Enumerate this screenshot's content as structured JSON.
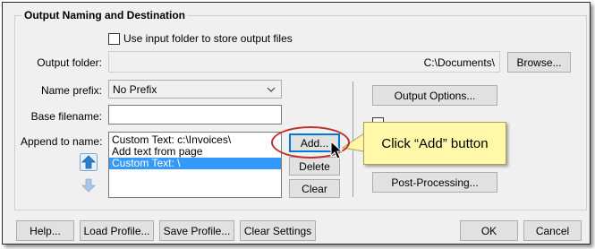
{
  "group": {
    "title": "Output Naming and Destination"
  },
  "checkbox_input_folder": {
    "label": "Use input folder to store output files",
    "checked": false
  },
  "output_folder": {
    "label": "Output folder:",
    "value": "C:\\Documents\\",
    "browse_label": "Browse..."
  },
  "name_prefix": {
    "label": "Name prefix:",
    "value": "No Prefix"
  },
  "base_filename": {
    "label": "Base filename:",
    "value": ""
  },
  "append_to_name": {
    "label": "Append to name:",
    "items": [
      "Custom Text: c:\\Invoices\\",
      "Add text from page",
      "Custom Text: \\"
    ],
    "selected_index": 2,
    "add_label": "Add...",
    "delete_label": "Delete",
    "clear_label": "Clear"
  },
  "right_panel": {
    "output_options_label": "Output Options...",
    "post_processing_label": "Post-Processing..."
  },
  "callout": {
    "text": "Click “Add”  button"
  },
  "footer": {
    "help_label": "Help...",
    "load_profile_label": "Load Profile...",
    "save_profile_label": "Save Profile...",
    "clear_settings_label": "Clear Settings",
    "ok_label": "OK",
    "cancel_label": "Cancel"
  },
  "colors": {
    "selection": "#3399ff",
    "callout_bg": "#fff8a8",
    "highlight_ellipse": "#c0302a",
    "arrow_up": "#2e7fd0"
  },
  "icons": [
    "chevron-down-icon",
    "arrow-up-icon",
    "arrow-down-icon",
    "mouse-cursor-icon"
  ]
}
